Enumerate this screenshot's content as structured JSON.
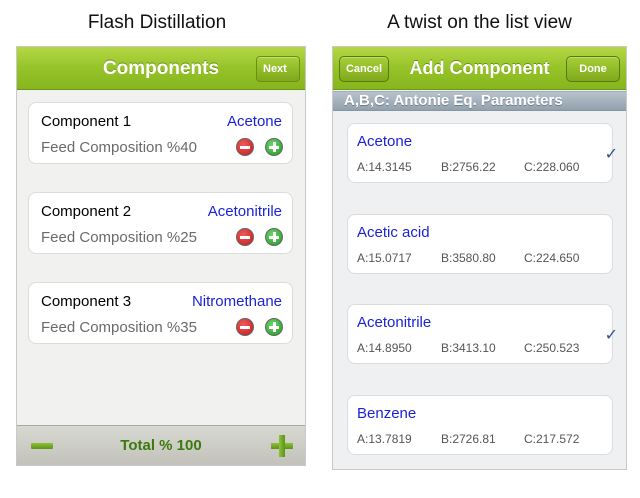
{
  "captions": {
    "left": "Flash Distillation",
    "right": "A twist on the list view"
  },
  "components_screen": {
    "title": "Components",
    "next_label": "Next",
    "items": [
      {
        "name": "Component 1",
        "chemical": "Acetone",
        "feed_label": "Feed Composition %",
        "feed_value": "40"
      },
      {
        "name": "Component 2",
        "chemical": "Acetonitrile",
        "feed_label": "Feed Composition %",
        "feed_value": "25"
      },
      {
        "name": "Component 3",
        "chemical": "Nitromethane",
        "feed_label": "Feed Composition %",
        "feed_value": "35"
      }
    ],
    "total_label": "Total % 100"
  },
  "add_component_screen": {
    "title": "Add Component",
    "cancel_label": "Cancel",
    "done_label": "Done",
    "section_header": "A,B,C: Antonie Eq. Parameters",
    "checkmark_glyph": "✓",
    "items": [
      {
        "name": "Acetone",
        "a": "A:14.3145",
        "b": "B:2756.22",
        "c": "C:228.060",
        "selected": true
      },
      {
        "name": "Acetic acid",
        "a": "A:15.0717",
        "b": "B:3580.80",
        "c": "C:224.650",
        "selected": false
      },
      {
        "name": "Acetonitrile",
        "a": "A:14.8950",
        "b": "B:3413.10",
        "c": "C:250.523",
        "selected": true
      },
      {
        "name": "Benzene",
        "a": "A:13.7819",
        "b": "B:2726.81",
        "c": "C:217.572",
        "selected": false
      }
    ]
  },
  "colors": {
    "accent_green": "#96c329",
    "chemical_blue": "#1a23d8",
    "total_green": "#3c7a0d",
    "section_header_gray": "#93a1ae"
  }
}
